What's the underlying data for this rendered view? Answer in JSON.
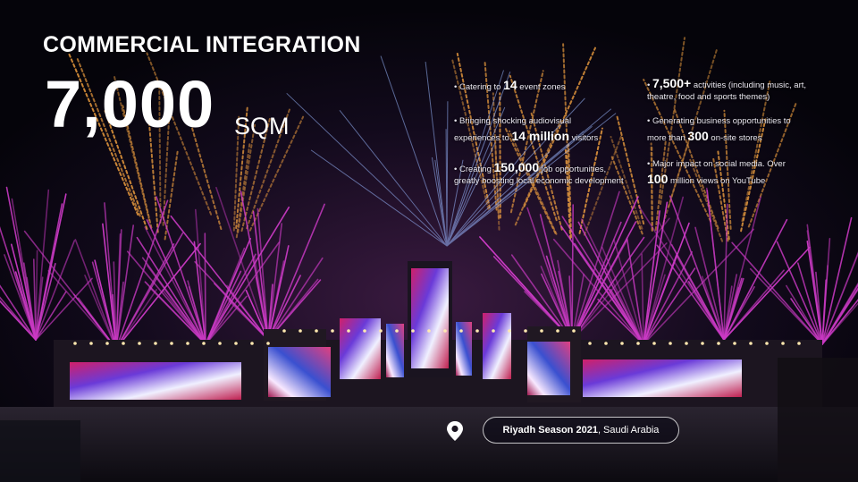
{
  "slide": {
    "title": "COMMERCIAL INTEGRATION",
    "big_number": "7,000",
    "big_unit": "SQM"
  },
  "stats": [
    {
      "pre": "• Catering to ",
      "highlight": "14",
      "post": " event zones"
    },
    {
      "pre": "• ",
      "highlight": "7,500+",
      "post": " activities (including music, art, theatre, food and sports themes)"
    },
    {
      "pre": "• Bringing shocking audiovisual experiences to ",
      "highlight": "14 million",
      "post": " visitors"
    },
    {
      "pre": "• Generating business opportunities to more than ",
      "highlight": "300",
      "post": " on-site stores"
    },
    {
      "pre": "• Creating ",
      "highlight": "150,000",
      "post": " job opportunities, greatly boosting local economic development"
    },
    {
      "pre": "• Major impact on social media. Over ",
      "highlight": "100",
      "post": " million views on YouTube"
    }
  ],
  "location": {
    "name": "Riyadh Season 2021",
    "place": ", Saudi Arabia",
    "icon": "location-pin-icon"
  },
  "colors": {
    "background": "#05040a",
    "firework_pink": "#e040d8",
    "firework_orange": "#f0a040",
    "text": "#ffffff"
  }
}
